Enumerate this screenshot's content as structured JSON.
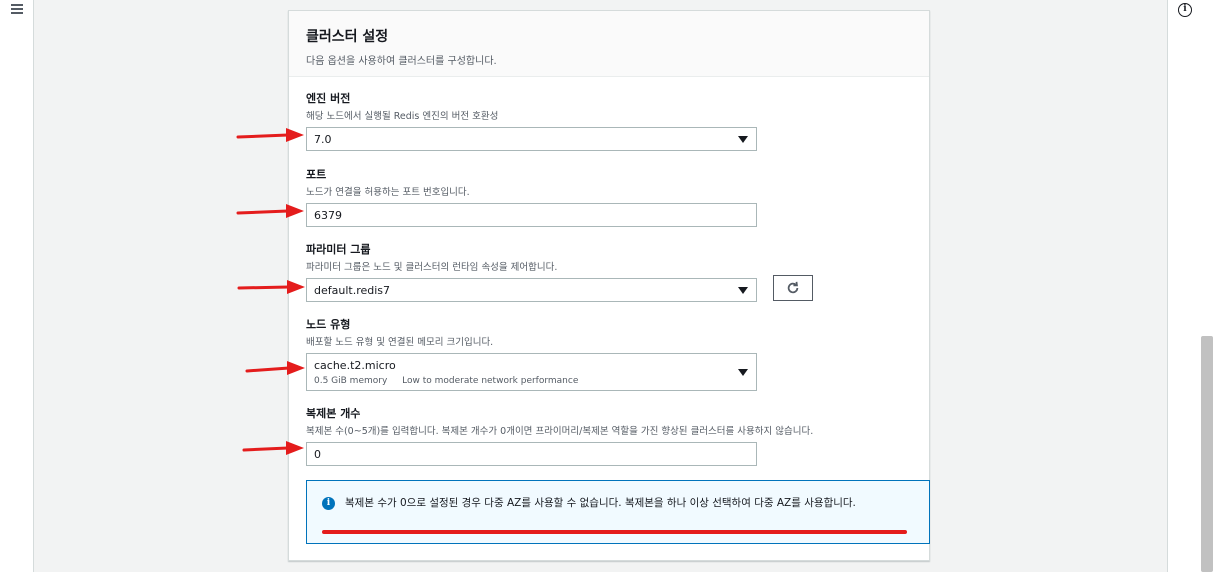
{
  "panel": {
    "title": "클러스터 설정",
    "description": "다음 옵션을 사용하여 클러스터를 구성합니다."
  },
  "engine_version": {
    "label": "엔진 버전",
    "description": "해당 노드에서 실행될 Redis 엔진의 버전 호환성",
    "value": "7.0"
  },
  "port": {
    "label": "포트",
    "description": "노드가 연결을 허용하는 포트 번호입니다.",
    "value": "6379"
  },
  "parameter_group": {
    "label": "파라미터 그룹",
    "description": "파라미터 그룹은 노드 및 클러스터의 런타임 속성을 제어합니다.",
    "value": "default.redis7"
  },
  "node_type": {
    "label": "노드 유형",
    "description": "배포할 노드 유형 및 연결된 메모리 크기입니다.",
    "value": "cache.t2.micro",
    "memory": "0.5 GiB memory",
    "performance": "Low to moderate network performance"
  },
  "replicas": {
    "label": "복제본 개수",
    "description": "복제본 수(0~5개)를 입력합니다. 복제본 개수가 0개이면 프라이머리/복제본 역할을 가진 향상된 클러스터를 사용하지 않습니다.",
    "value": "0"
  },
  "alert": {
    "text": "복제본 수가 0으로 설정된 경우 다중 AZ를 사용할 수 없습니다. 복제본을 하나 이상 선택하여 다중 AZ를 사용합니다."
  },
  "colors": {
    "annotation_red": "#e41c1c",
    "alert_blue": "#0073bb",
    "alert_bg": "#f1faff"
  }
}
